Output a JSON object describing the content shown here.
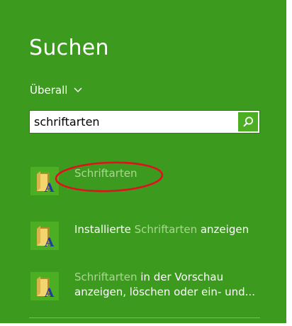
{
  "search_pane": {
    "title": "Suchen",
    "scope_label": "Überall",
    "query": "schriftarten",
    "colors": {
      "background": "#3c9a1e",
      "highlight": "#a9d98f",
      "button": "#4cae22"
    }
  },
  "results": [
    {
      "icon": "fonts-folder-icon",
      "label_match": "Schriftarten"
    },
    {
      "icon": "fonts-folder-icon",
      "label_pre": "Installierte ",
      "label_match": "Schriftarten",
      "label_post": " anzeigen"
    },
    {
      "icon": "fonts-folder-icon",
      "label_match": "Schriftarten",
      "label_post": " in der Vorschau",
      "label_line2": "anzeigen, löschen oder ein- und..."
    }
  ],
  "annotation": {
    "shape": "red-ellipse",
    "color": "#e0101e",
    "target": "Schriftarten"
  }
}
